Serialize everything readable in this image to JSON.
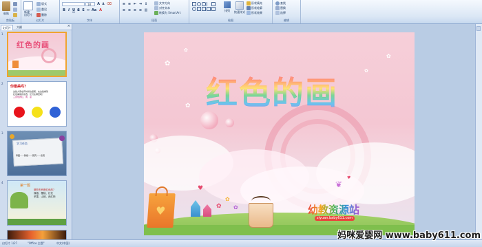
{
  "ribbon": {
    "groups": [
      {
        "label": "剪贴板"
      },
      {
        "label": "幻灯片"
      },
      {
        "label": "字体"
      },
      {
        "label": "段落"
      },
      {
        "label": "绘图"
      },
      {
        "label": "编辑"
      }
    ],
    "paste_label": "粘贴",
    "new_slide_label": "新建\n幻灯片",
    "layout_label": "版式",
    "reset_label": "重设",
    "delete_label": "删除",
    "font_size": "18",
    "text_direction_label": "文字方向",
    "align_text_label": "对齐文本",
    "smartart_label": "转换为 SmartArt",
    "arrange_label": "排列",
    "quick_styles_label": "快速样式",
    "shape_fill_label": "形状填充",
    "shape_outline_label": "形状轮廓",
    "shape_effects_label": "形状效果",
    "find_label": "查找",
    "replace_label": "替换",
    "select_label": "选择"
  },
  "pane": {
    "tabs": [
      "幻灯片",
      "大纲"
    ],
    "slides": [
      {
        "num": "1",
        "title": "红色的画"
      },
      {
        "num": "2",
        "title": "你最美吗?",
        "lines": [
          "这些大家在有时候也很美，在这些看到",
          "红色美丽的东西，它们在哪里呢？",
          "三原色的红、黄、蓝"
        ],
        "colors": [
          "#e8141b",
          "#f5e11a",
          "#2f62d6"
        ]
      },
      {
        "num": "3",
        "title": "学习任务",
        "line": "导图——猜想——研究——表现"
      },
      {
        "num": "4",
        "title": "第一题",
        "lines": [
          "哪些东西是红色的？",
          "辣椒、樱桃、红花",
          "苹果、山楂、西红柿"
        ]
      }
    ]
  },
  "slide": {
    "title": "红色的画",
    "logo": "幼教资源站",
    "logo_url": "ziyuan.baby611.com"
  },
  "status": {
    "slide_info": "幻灯片 1/27",
    "theme": "\"Office 主题\"",
    "language": "中文(中国)"
  },
  "watermark": "妈咪爱婴网 www.baby611.com",
  "colors": {
    "ribbon_bg": "#dbe7f5",
    "workspace_bg": "#b9cce4",
    "slide_pink": "#f4c7d3"
  }
}
